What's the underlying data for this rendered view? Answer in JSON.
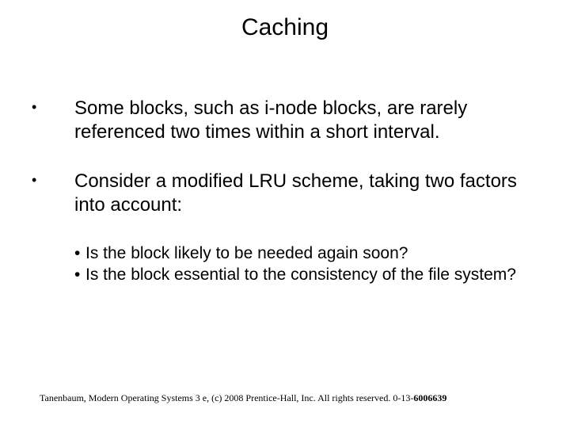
{
  "title": "Caching",
  "bullets": {
    "b1": "Some blocks, such as i-node blocks, are rarely referenced two times within a short interval.",
    "b2": "Consider a modified LRU scheme, taking two factors into account:",
    "sub1": "Is the block likely to be needed again soon?",
    "sub2": "Is the block essential to the consistency of the file system?"
  },
  "footer": {
    "text": "Tanenbaum, Modern Operating Systems 3 e, (c) 2008 Prentice-Hall, Inc. All rights reserved. 0-13-",
    "isbn_tail": "6006639"
  }
}
